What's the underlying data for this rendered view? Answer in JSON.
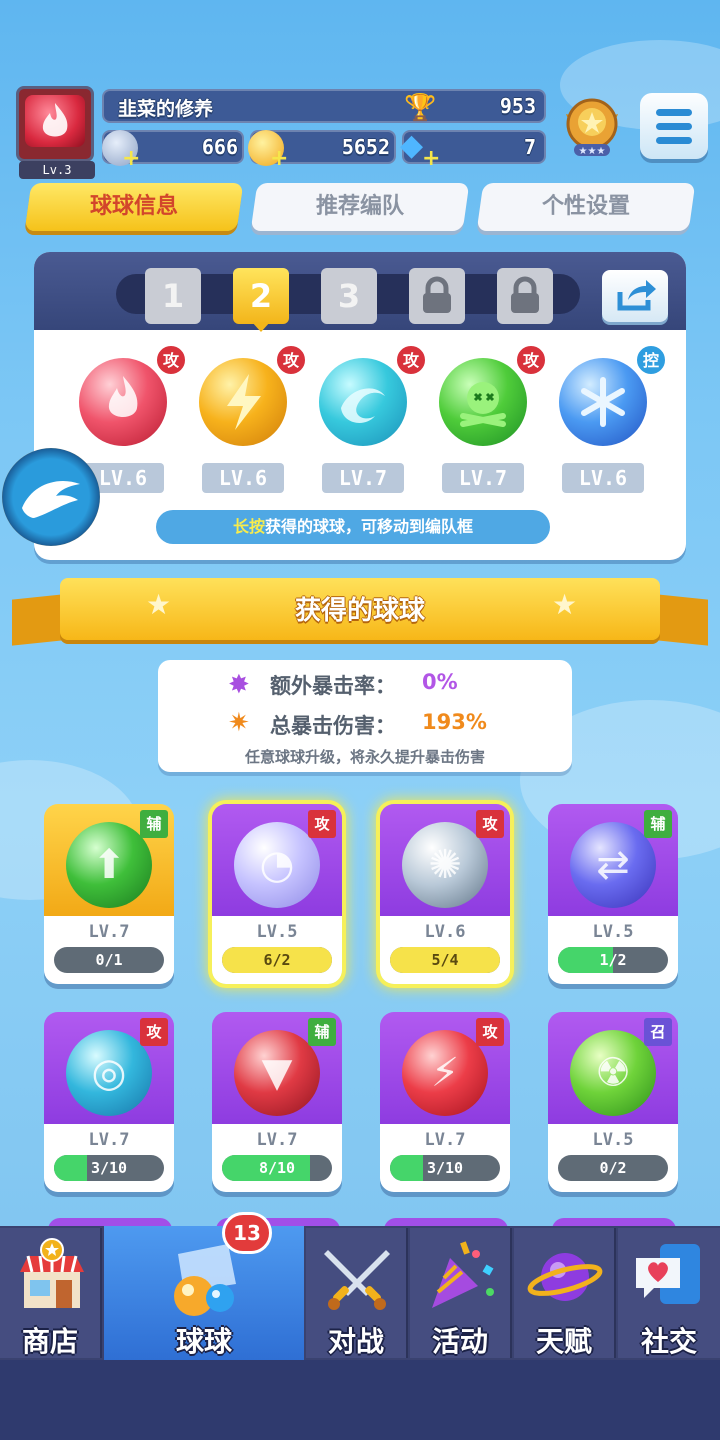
{
  "header": {
    "level_label": "Lv.3",
    "player_name": "韭菜的修养",
    "trophies": "953",
    "currency_a": "666",
    "coins": "5652",
    "gems": "7"
  },
  "tabs": [
    {
      "label": "球球信息",
      "active": true
    },
    {
      "label": "推荐编队",
      "active": false
    },
    {
      "label": "个性设置",
      "active": false
    }
  ],
  "team": {
    "slots": [
      "1",
      "2",
      "3"
    ],
    "active_slot": "2",
    "orbs": [
      {
        "tag": "攻",
        "level": "LV.6",
        "icon": "fire-orb-icon"
      },
      {
        "tag": "攻",
        "level": "LV.6",
        "icon": "lightning-orb-icon"
      },
      {
        "tag": "攻",
        "level": "LV.7",
        "icon": "wind-orb-icon"
      },
      {
        "tag": "攻",
        "level": "LV.7",
        "icon": "poison-orb-icon"
      },
      {
        "tag": "控",
        "level": "LV.6",
        "icon": "ice-orb-icon"
      }
    ],
    "hint_highlight": "长按",
    "hint_text": "获得的球球，可移动到编队框"
  },
  "banner_title": "获得的球球",
  "crit": {
    "rate_label": "额外暴击率：",
    "rate_value": "0%",
    "damage_label": "总暴击伤害：",
    "damage_value": "193%",
    "note": "任意球球升级，将永久提升暴击伤害"
  },
  "cards": [
    {
      "tag": "辅",
      "level": "LV.7",
      "progress": "0/1",
      "fraction": 0,
      "style": "gold",
      "icon": "star-arrow-orb-icon"
    },
    {
      "tag": "攻",
      "level": "LV.5",
      "progress": "6/2",
      "fraction": 1,
      "style": "purple",
      "ready": true,
      "icon": "moon-orb-icon"
    },
    {
      "tag": "攻",
      "level": "LV.6",
      "progress": "5/4",
      "fraction": 1,
      "style": "purple",
      "ready": true,
      "icon": "vortex-orb-icon"
    },
    {
      "tag": "辅",
      "level": "LV.5",
      "progress": "1/2",
      "fraction": 0.5,
      "style": "purple",
      "icon": "swap-orb-icon"
    },
    {
      "tag": "攻",
      "level": "LV.7",
      "progress": "3/10",
      "fraction": 0.3,
      "style": "purple",
      "icon": "whirlpool-orb-icon"
    },
    {
      "tag": "辅",
      "level": "LV.7",
      "progress": "8/10",
      "fraction": 0.8,
      "style": "purple",
      "icon": "fang-orb-icon"
    },
    {
      "tag": "攻",
      "level": "LV.7",
      "progress": "3/10",
      "fraction": 0.3,
      "style": "purple",
      "icon": "slash-orb-icon"
    },
    {
      "tag": "召",
      "level": "LV.5",
      "progress": "0/2",
      "fraction": 0,
      "style": "purple",
      "icon": "radiation-orb-icon"
    }
  ],
  "tag_colors": {
    "攻": "#d9323c",
    "辅": "#3fae3f",
    "控": "#2f9ee0",
    "召": "#6a52d6"
  },
  "nav": {
    "badge": "13",
    "items": [
      {
        "label": "商店",
        "icon": "shop-icon"
      },
      {
        "label": "球球",
        "icon": "balls-icon",
        "active": true
      },
      {
        "label": "对战",
        "icon": "swords-icon"
      },
      {
        "label": "活动",
        "icon": "party-popper-icon"
      },
      {
        "label": "天赋",
        "icon": "planet-icon"
      },
      {
        "label": "社交",
        "icon": "chat-heart-icon"
      }
    ]
  }
}
